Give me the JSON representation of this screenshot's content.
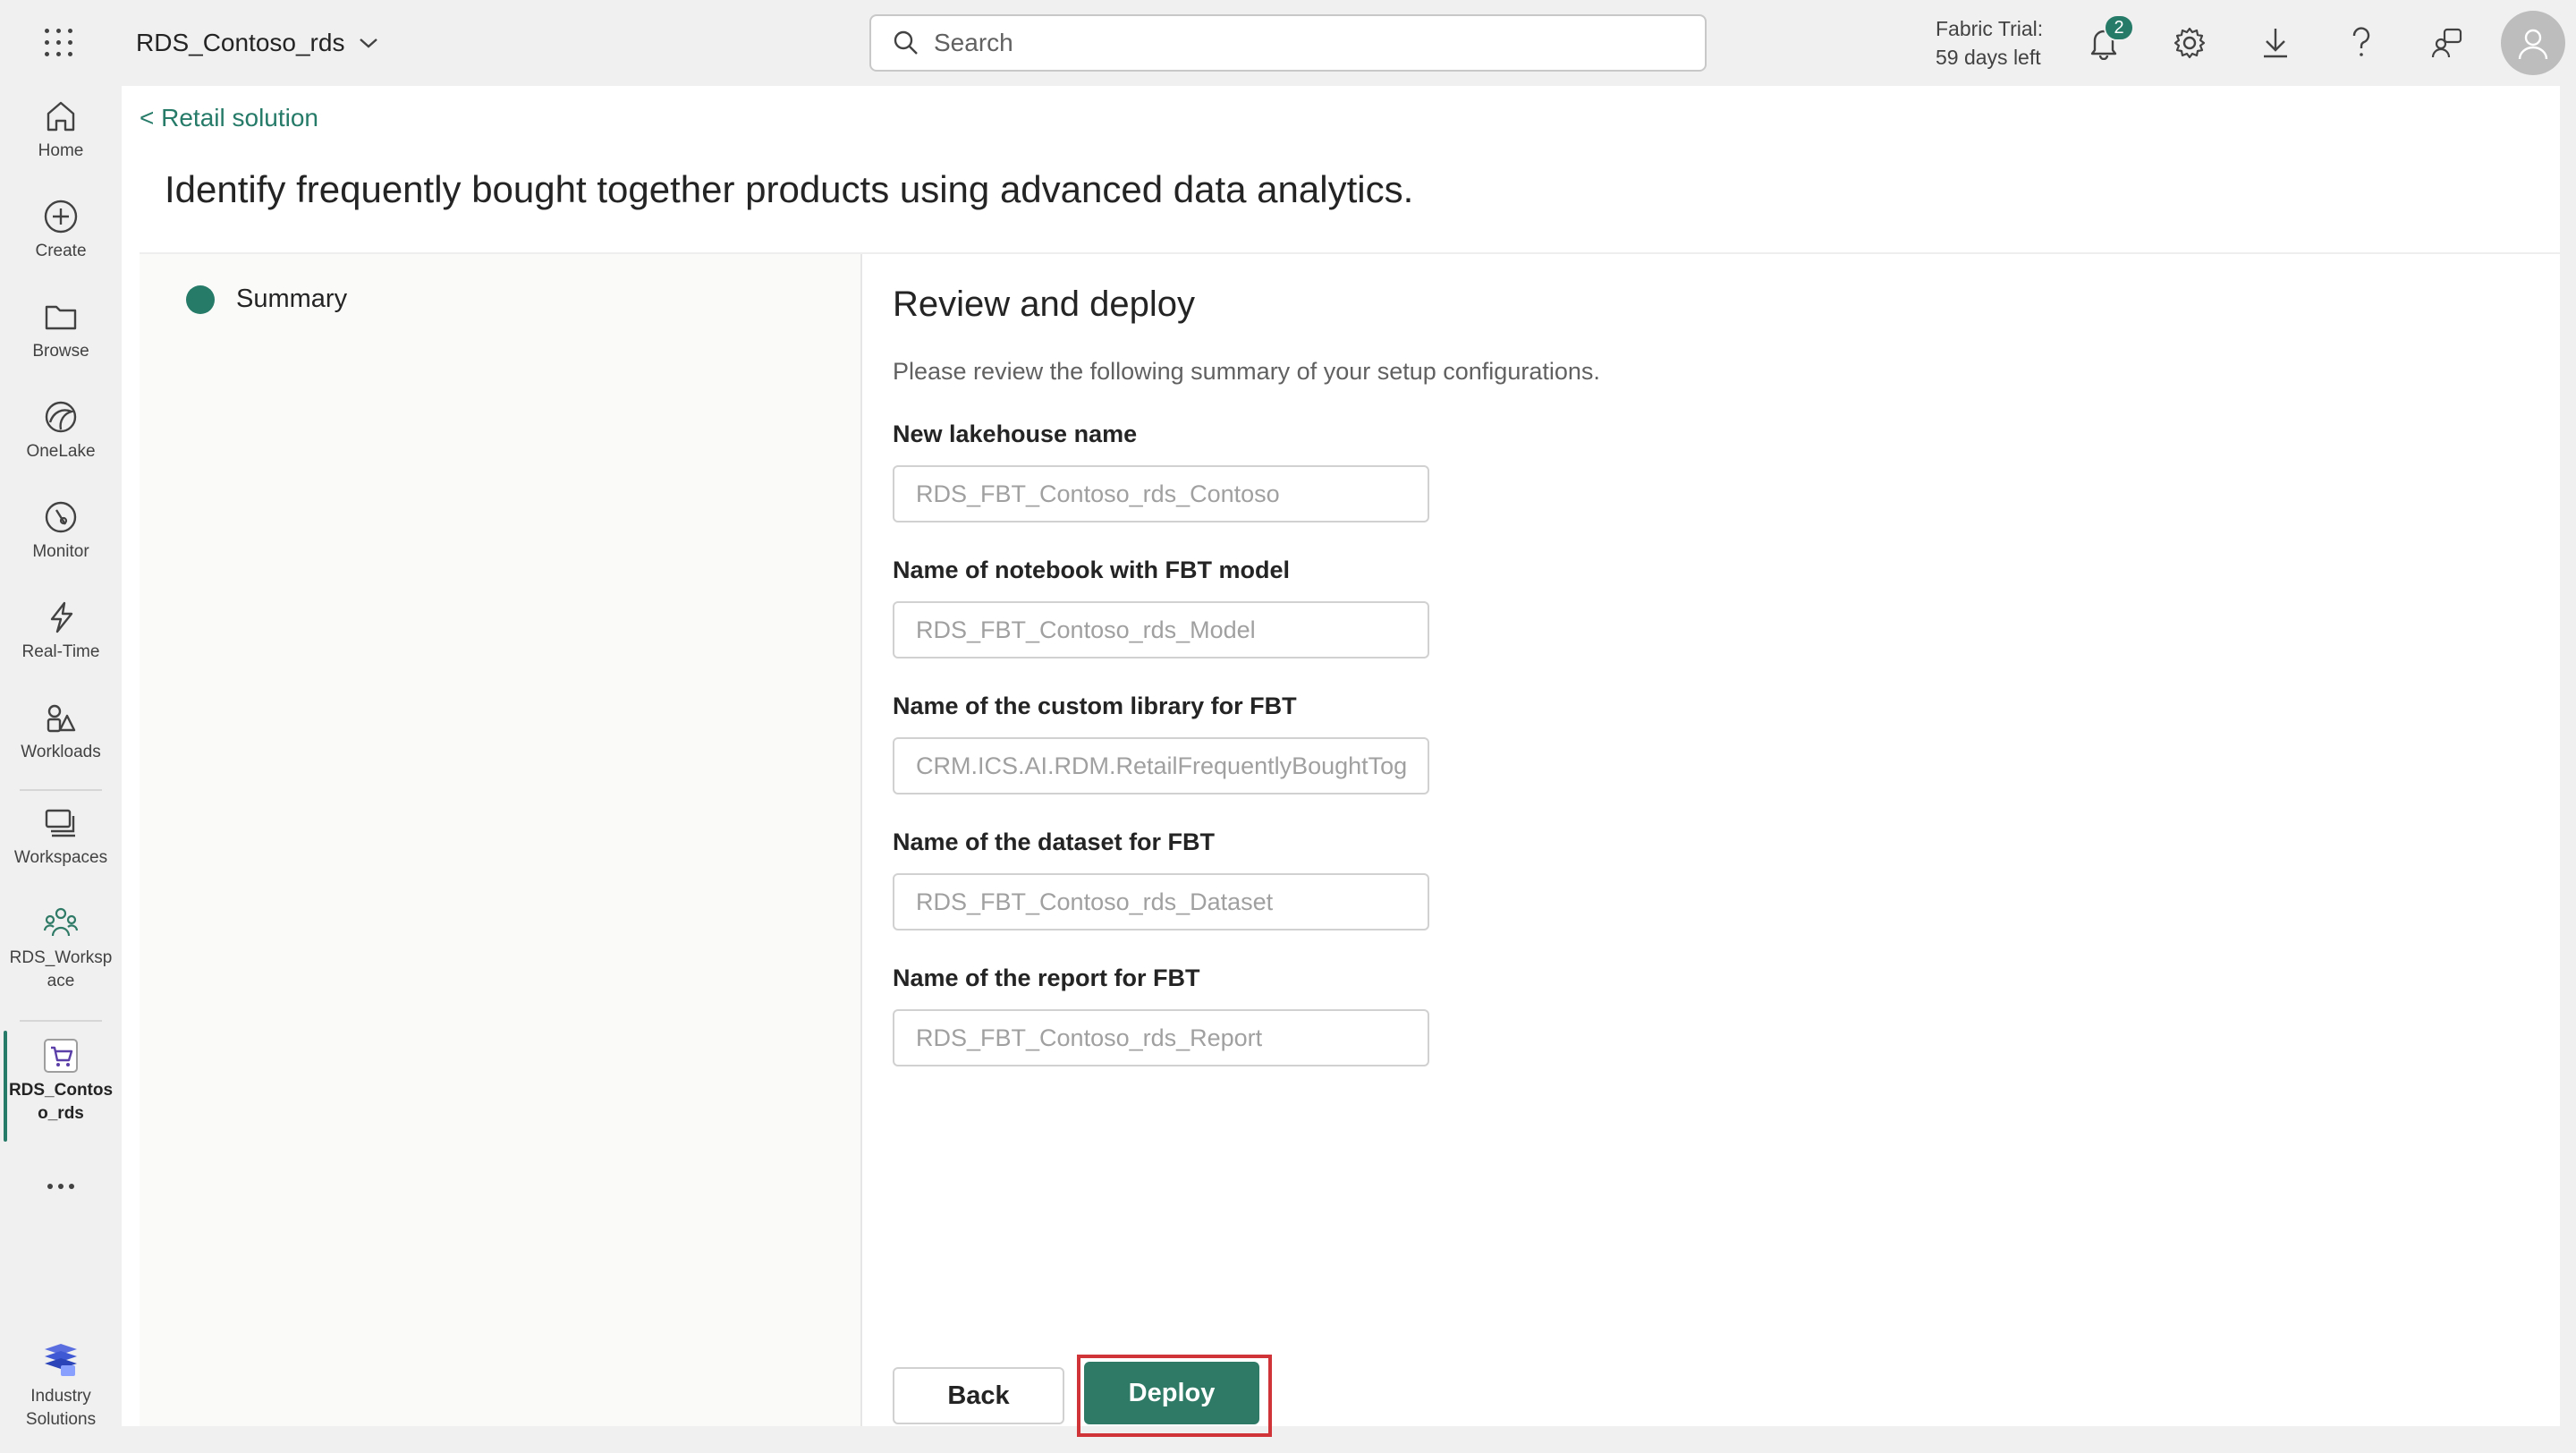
{
  "topbar": {
    "workspace_name": "RDS_Contoso_rds",
    "search_placeholder": "Search",
    "trial_line1": "Fabric Trial:",
    "trial_line2": "59 days left",
    "notification_count": "2"
  },
  "leftnav": {
    "items": [
      {
        "label": "Home",
        "icon": "home-icon"
      },
      {
        "label": "Create",
        "icon": "plus-circle-icon"
      },
      {
        "label": "Browse",
        "icon": "folder-icon"
      },
      {
        "label": "OneLake",
        "icon": "onelake-icon"
      },
      {
        "label": "Monitor",
        "icon": "monitor-icon"
      },
      {
        "label": "Real-Time",
        "icon": "lightning-icon"
      },
      {
        "label": "Workloads",
        "icon": "workloads-icon"
      },
      {
        "label": "Workspaces",
        "icon": "workspaces-icon"
      },
      {
        "label": "RDS_Worksp\nace",
        "icon": "workspace-people-icon"
      },
      {
        "label": "RDS_Contos\no_rds",
        "icon": "cart-icon"
      },
      {
        "label": "Industry\nSolutions",
        "icon": "industry-solutions-icon"
      }
    ],
    "more_label": "More"
  },
  "breadcrumb": "< Retail solution",
  "page_title": "Identify frequently bought together products using advanced data analytics.",
  "steps": [
    {
      "label": "Summary",
      "status": "active"
    }
  ],
  "review": {
    "title": "Review and deploy",
    "description": "Please review the following summary of your setup configurations.",
    "fields": [
      {
        "label": "New lakehouse name",
        "value": "RDS_FBT_Contoso_rds_Contoso"
      },
      {
        "label": "Name of notebook with FBT model",
        "value": "RDS_FBT_Contoso_rds_Model"
      },
      {
        "label": "Name of the custom library for FBT",
        "value": "CRM.ICS.AI.RDM.RetailFrequentlyBoughtTogether"
      },
      {
        "label": "Name of the dataset for FBT",
        "value": "RDS_FBT_Contoso_rds_Dataset"
      },
      {
        "label": "Name of the report for FBT",
        "value": "RDS_FBT_Contoso_rds_Report"
      }
    ],
    "back_label": "Back",
    "deploy_label": "Deploy"
  },
  "colors": {
    "accent": "#257a68",
    "highlight": "#d13438"
  }
}
